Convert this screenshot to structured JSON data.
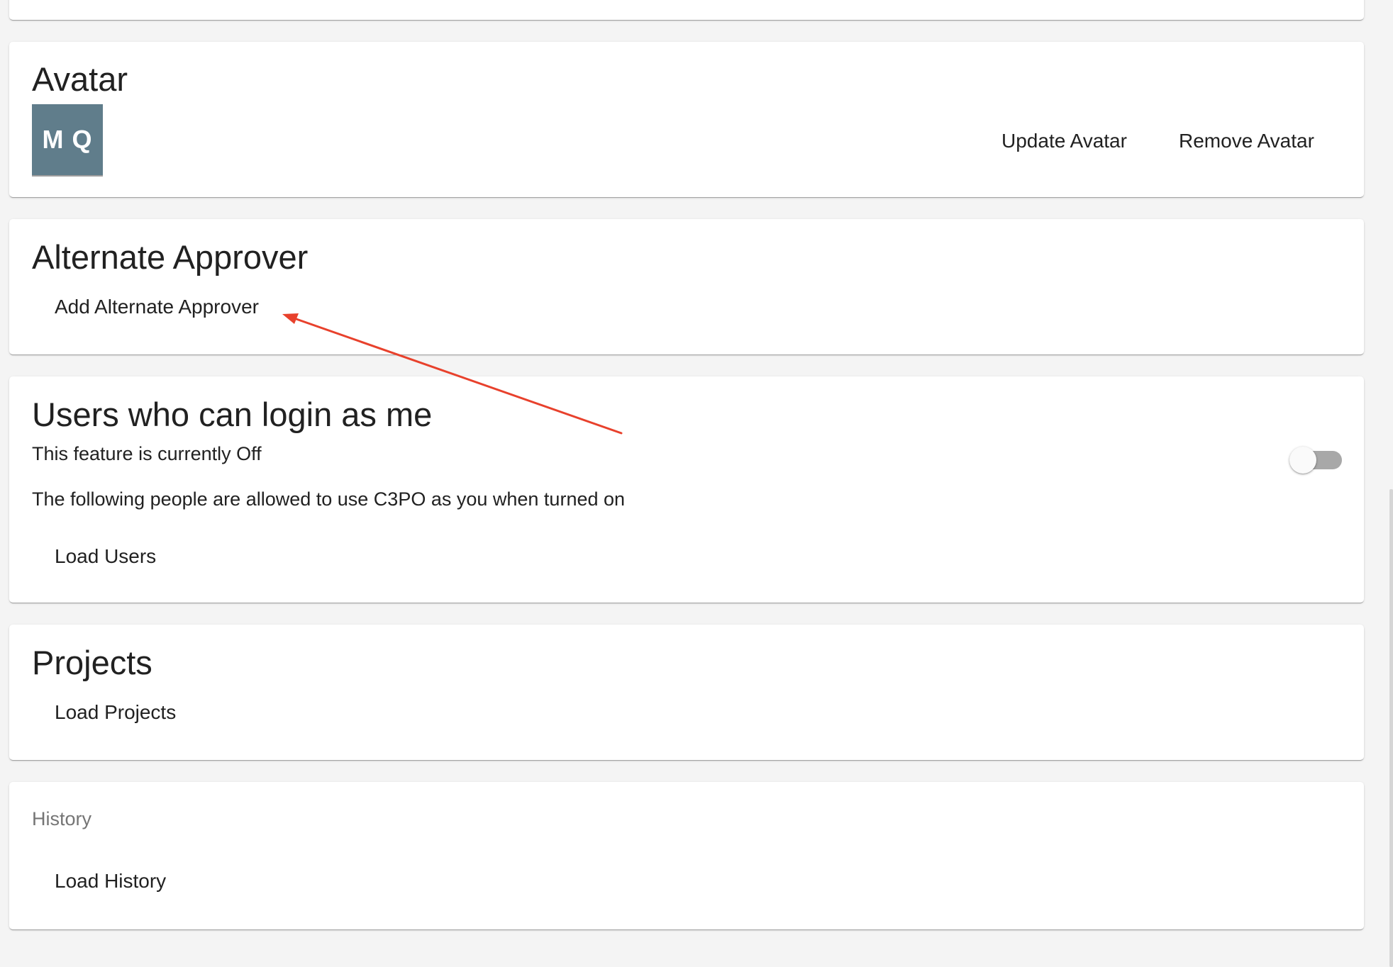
{
  "avatar_section": {
    "title": "Avatar",
    "initials": "M Q",
    "update_label": "Update Avatar",
    "remove_label": "Remove Avatar"
  },
  "approver_section": {
    "title": "Alternate Approver",
    "add_label": "Add Alternate Approver"
  },
  "login_section": {
    "title": "Users who can login as me",
    "status_text": "This feature is currently Off",
    "description": "The following people are allowed to use C3PO as you when turned on",
    "load_label": "Load Users",
    "toggle_on": false
  },
  "projects_section": {
    "title": "Projects",
    "load_label": "Load Projects"
  },
  "history_section": {
    "label": "History",
    "load_label": "Load History"
  },
  "annotation": {
    "arrow_color": "#e8412c"
  },
  "colors": {
    "avatar_bg": "#607d8b",
    "page_bg": "#f4f4f4"
  }
}
